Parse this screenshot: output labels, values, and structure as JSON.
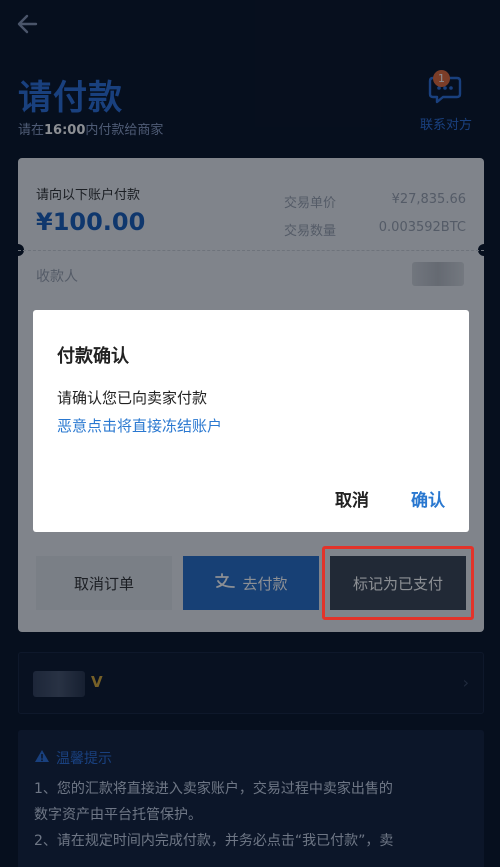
{
  "header": {
    "title": "请付款",
    "subtitle_prefix": "请在",
    "subtitle_time": "16:00",
    "subtitle_suffix": "内付款给商家",
    "contact_label": "联系对方",
    "contact_badge": "1"
  },
  "order": {
    "pay_label": "请向以下账户付款",
    "amount": "¥100.00",
    "price_label": "交易单价",
    "price_value": "¥27,835.66",
    "qty_label": "交易数量",
    "qty_value": "0.003592BTC",
    "payee_label": "收款人"
  },
  "actions": {
    "cancel_order": "取消订单",
    "go_pay": "去付款",
    "mark_paid": "标记为已支付"
  },
  "dialog": {
    "title": "付款确认",
    "message": "请确认您已向卖家付款",
    "warning": "恶意点击将直接冻结账户",
    "cancel": "取消",
    "confirm": "确认"
  },
  "tips": {
    "title": "温馨提示",
    "line1": "1、您的汇款将直接进入卖家账户，交易过程中卖家出售的",
    "line2": "数字资产由平台托管保护。",
    "line3": "2、请在规定时间内完成付款，并务必点击“我已付款”，卖"
  },
  "colors": {
    "background": "#0c1628",
    "accent": "#2f6fd8",
    "primary_button": "#2a6fc7",
    "highlight": "#e3332a"
  }
}
